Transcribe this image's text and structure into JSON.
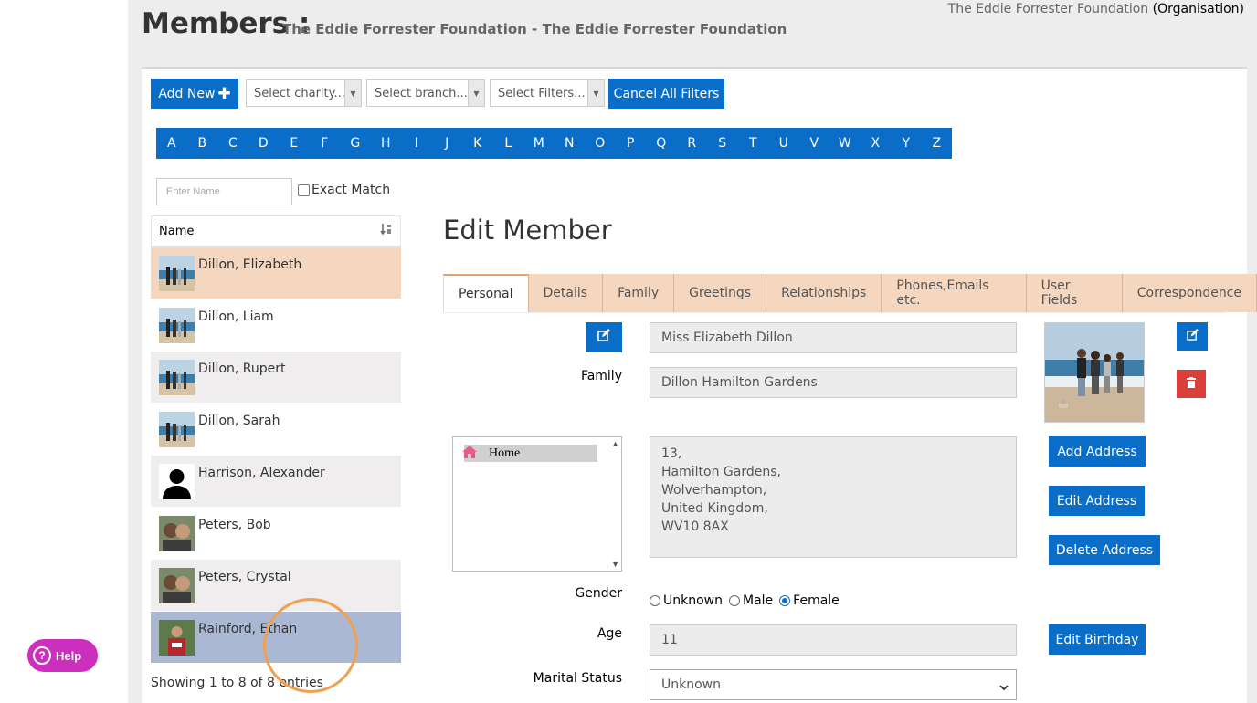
{
  "header": {
    "title": "Members :",
    "subtitle": "The Eddie Forrester Foundation - The Eddie Forrester Foundation",
    "org_name": "The Eddie Forrester Foundation",
    "org_type": "(Organisation)"
  },
  "toolbar": {
    "add_new_label": "Add New",
    "charity_placeholder": "Select charity...",
    "branch_placeholder": "Select branch...",
    "filters_placeholder": "Select Filters...",
    "cancel_filters_label": "Cancel All Filters"
  },
  "alphabet": [
    "A",
    "B",
    "C",
    "D",
    "E",
    "F",
    "G",
    "H",
    "I",
    "J",
    "K",
    "L",
    "M",
    "N",
    "O",
    "P",
    "Q",
    "R",
    "S",
    "T",
    "U",
    "V",
    "W",
    "X",
    "Y",
    "Z"
  ],
  "search": {
    "placeholder": "Enter Name",
    "exact_match_label": "Exact Match"
  },
  "member_list": {
    "column_header": "Name",
    "rows": [
      {
        "name": "Dillon, Elizabeth",
        "thumb": "family-photo",
        "state": "selected"
      },
      {
        "name": "Dillon, Liam",
        "thumb": "family-photo",
        "state": "normal"
      },
      {
        "name": "Dillon, Rupert",
        "thumb": "family-photo",
        "state": "alt"
      },
      {
        "name": "Dillon, Sarah",
        "thumb": "family-photo",
        "state": "normal"
      },
      {
        "name": "Harrison, Alexander",
        "thumb": "silhouette",
        "state": "alt"
      },
      {
        "name": "Peters, Bob",
        "thumb": "couple-photo",
        "state": "normal"
      },
      {
        "name": "Peters, Crystal",
        "thumb": "couple-photo",
        "state": "alt"
      },
      {
        "name": "Rainford, Ethan",
        "thumb": "person-photo",
        "state": "hover"
      }
    ],
    "showing_text": "Showing 1 to 8 of 8 entries"
  },
  "help_label": "Help",
  "edit": {
    "title": "Edit Member",
    "tabs": [
      "Personal",
      "Details",
      "Family",
      "Greetings",
      "Relationships",
      "Phones,Emails etc.",
      "User Fields",
      "Correspondence"
    ],
    "active_tab": "Personal",
    "full_name": "Miss Elizabeth Dillon",
    "family_label": "Family",
    "family_value": "Dillon Hamilton Gardens",
    "address_list_item": "Home",
    "address_lines": [
      "13,",
      "Hamilton Gardens,",
      "Wolverhampton,",
      "United Kingdom,",
      "WV10 8AX"
    ],
    "add_address_label": "Add Address",
    "edit_address_label": "Edit Address",
    "delete_address_label": "Delete Address",
    "gender_label": "Gender",
    "gender_options": [
      "Unknown",
      "Male",
      "Female"
    ],
    "gender_selected": "Female",
    "age_label": "Age",
    "age_value": "11",
    "edit_birthday_label": "Edit Birthday",
    "marital_label": "Marital Status",
    "marital_value": "Unknown"
  },
  "colors": {
    "primary": "#0a6ec8",
    "danger": "#d9403a",
    "tab_bg": "#f5d6bf",
    "selected_row": "#f5d6bf",
    "hover_row": "#aab8d4",
    "help": "#cc2fbe"
  }
}
